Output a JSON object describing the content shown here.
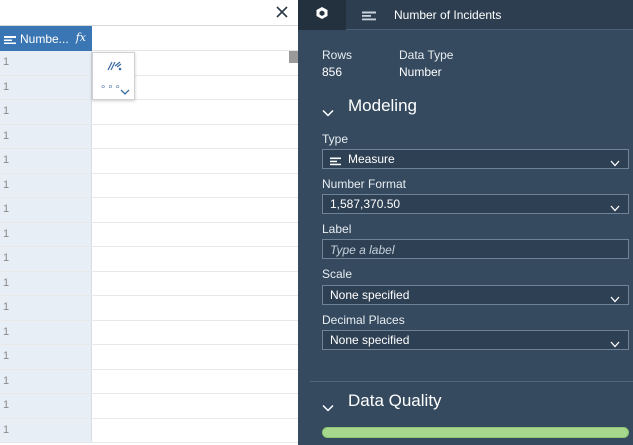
{
  "grid": {
    "column_header": {
      "label": "Numbe...",
      "fx": "fx"
    },
    "rows": [
      "1",
      "1",
      "1",
      "1",
      "1",
      "1",
      "1",
      "1",
      "1",
      "1",
      "1",
      "1",
      "1",
      "1",
      "1",
      "1"
    ],
    "popup": {
      "dots": "∘∘∘"
    }
  },
  "panel": {
    "header_title": "Number of Incidents",
    "rows_label": "Rows",
    "rows_value": "856",
    "datatype_label": "Data Type",
    "datatype_value": "Number",
    "modeling": {
      "title": "Modeling",
      "type_label": "Type",
      "type_value": "Measure",
      "number_format_label": "Number Format",
      "number_format_value": "1,587,370.50",
      "label_label": "Label",
      "label_placeholder": "Type a label",
      "scale_label": "Scale",
      "scale_value": "None specified",
      "decimal_label": "Decimal Places",
      "decimal_value": "None specified"
    },
    "data_quality": {
      "title": "Data Quality",
      "bar_color": "#a6d78c"
    }
  },
  "colors": {
    "panel_bg": "#354a5f",
    "header_bg": "#2c3e50",
    "column_header_bg": "#3a76b3"
  }
}
